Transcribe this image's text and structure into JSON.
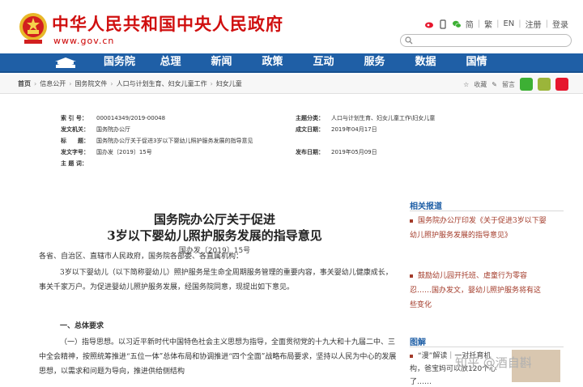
{
  "header": {
    "site_title": "中华人民共和国中央人民政府",
    "site_url": "www.gov.cn",
    "links": [
      "简",
      "繁",
      "EN",
      "注册",
      "登录"
    ]
  },
  "nav": {
    "items": [
      "国务院",
      "总理",
      "新闻",
      "政策",
      "互动",
      "服务",
      "数据",
      "国情"
    ]
  },
  "breadcrumb": {
    "items": [
      "首页",
      "信息公开",
      "国务院文件",
      "人口与计划生育、妇女儿童工作",
      "妇女儿童"
    ],
    "actions": [
      "收藏",
      "留言"
    ]
  },
  "info": {
    "index_label": "索 引 号：",
    "index_value": "000014349/2019-00048",
    "topic_label": "主题分类：",
    "topic_value": "人口与计划生育、妇女儿童工作\\妇女儿童",
    "issuer_label": "发文机关：",
    "issuer_value": "国务院办公厅",
    "date_label": "成文日期：",
    "date_value": "2019年04月17日",
    "title_label": "标　　题：",
    "title_value": "国务院办公厅关于促进3岁以下婴幼儿照护服务发展的指导意见",
    "docno_label": "发文字号：",
    "docno_value": "国办发〔2019〕15号",
    "pub_label": "发布日期：",
    "pub_value": "2019年05月09日",
    "keywords_label": "主 题 词："
  },
  "article": {
    "title_line1": "国务院办公厅关于促进",
    "title_line2": "3岁以下婴幼儿照护服务发展的指导意见",
    "doc_number": "国办发〔2019〕15号",
    "salutation": "各省、自治区、直辖市人民政府，国务院各部委、各直属机构：",
    "p1": "3岁以下婴幼儿（以下简称婴幼儿）照护服务是生命全周期服务管理的重要内容，事关婴幼儿健康成长，事关千家万户。为促进婴幼儿照护服务发展，经国务院同意，现提出如下意见。",
    "section1": "一、总体要求",
    "p2": "（一）指导思想。以习近平新时代中国特色社会主义思想为指导，全面贯彻党的十九大和十九届二中、三中全会精神，按照统筹推进“五位一体”总体布局和协调推进“四个全面”战略布局要求，坚持以人民为中心的发展思想，以需求和问题为导向，推进供给侧结构"
  },
  "sidebar": {
    "related_heading": "相关报道",
    "related": [
      "国务院办公厅印发《关于促进3岁以下婴幼儿照护服务发展的指导意见》",
      "鼓励幼儿园开托班、虐童行为零容忍……国办发文，婴幼儿照护服务将有这些变化"
    ],
    "graphic_heading": "图解",
    "graphic_item": "“漫”解读｜一对托育机构，爸宝妈可以放120个心了……"
  },
  "watermark": "知乎 @酒自斟",
  "colors": {
    "nav_blue": "#1f5fa6",
    "title_red": "#d00f0f",
    "link_red": "#a33b2a"
  }
}
